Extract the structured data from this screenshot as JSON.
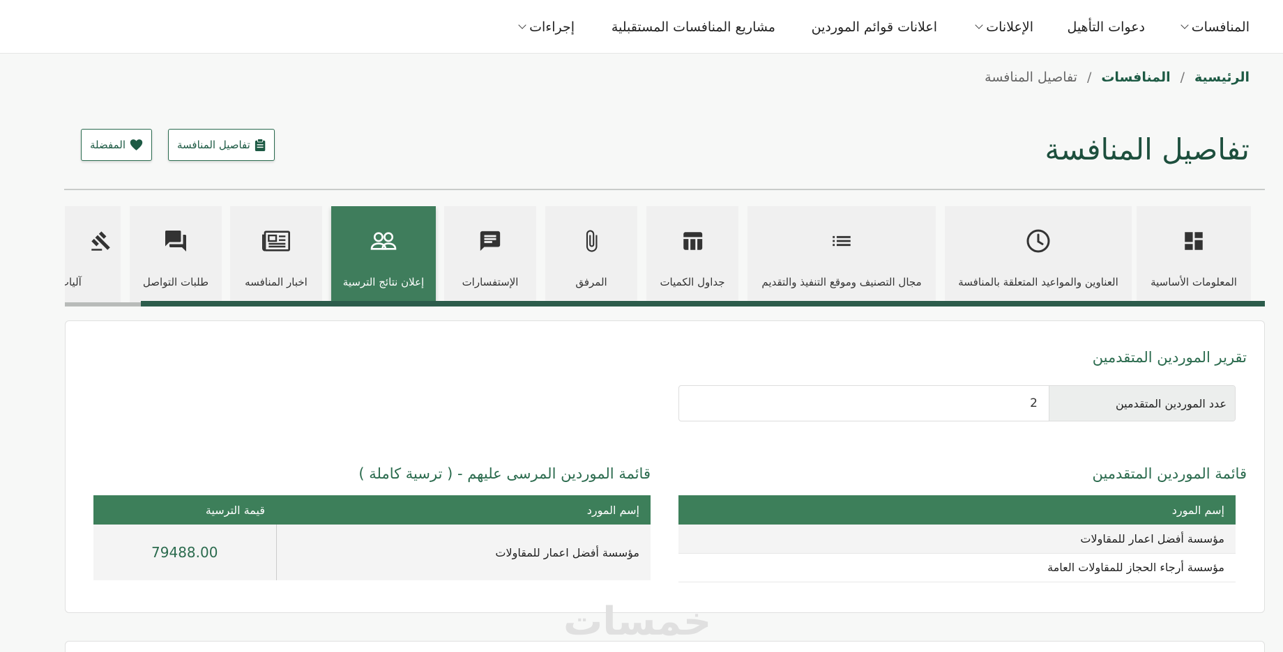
{
  "nav": {
    "items": [
      {
        "label": "المنافسات",
        "dropdown": true
      },
      {
        "label": "دعوات التأهيل",
        "dropdown": false
      },
      {
        "label": "الإعلانات",
        "dropdown": true
      },
      {
        "label": "اعلانات قوائم الموردين",
        "dropdown": false
      },
      {
        "label": "مشاريع المنافسات المستقبلية",
        "dropdown": false
      },
      {
        "label": "إجراءات",
        "dropdown": true
      }
    ]
  },
  "breadcrumb": {
    "home": "الرئيسية",
    "section": "المنافسات",
    "current": "تفاصيل المنافسة",
    "separator": "/"
  },
  "page": {
    "title": "تفاصيل المنافسة",
    "details_button": "تفاصيل المنافسة",
    "favorite_button": "المفضلة"
  },
  "tabs": [
    {
      "label": "المعلومات الأساسية",
      "icon": "dashboard-icon"
    },
    {
      "label": "العناوين والمواعيد المتعلقة بالمنافسة",
      "icon": "clock-icon"
    },
    {
      "label": "مجال التصنيف وموقع التنفيذ والتقديم",
      "icon": "list-icon"
    },
    {
      "label": "جداول الكميات",
      "icon": "table-icon"
    },
    {
      "label": "المرفق",
      "icon": "paperclip-icon"
    },
    {
      "label": "الإستفسارات",
      "icon": "chat-icon"
    },
    {
      "label": "إعلان نتائج الترسية",
      "icon": "people-icon",
      "active": true
    },
    {
      "label": "اخبار المنافسه",
      "icon": "newspaper-icon"
    },
    {
      "label": "طلبات التواصل",
      "icon": "forum-icon"
    },
    {
      "label": "آليات المح",
      "icon": "gavel-icon"
    }
  ],
  "report": {
    "title": "تقرير الموردين المتقدمين",
    "count_label": "عدد الموردين المتقدمين",
    "count_value": "2"
  },
  "applicants": {
    "title": "قائمة الموردين المتقدمين",
    "column": "إسم المورد",
    "rows": [
      "مؤسسة أفضل اعمار للمقاولات",
      "مؤسسة أرجاء الحجاز للمقاولات العامة"
    ]
  },
  "awarded": {
    "title": "قائمة الموردين المرسى عليهم - ( ترسية كاملة )",
    "col_name": "إسم المورد",
    "col_value": "قيمة الترسية",
    "rows": [
      {
        "name": "مؤسسة أفضل اعمار للمقاولات",
        "value": "79488.00"
      }
    ]
  },
  "watermark": "خمسات",
  "colors": {
    "primary": "#3d7f5a",
    "dark": "#1d4f3d",
    "bar": "#2c5c4b"
  }
}
